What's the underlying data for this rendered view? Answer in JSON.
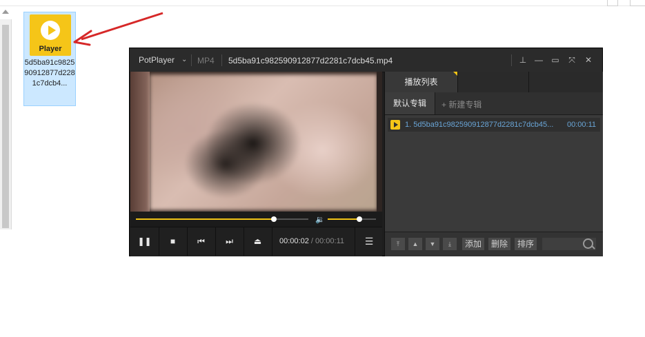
{
  "desktop": {
    "file_icon_label": "Player",
    "file_name": "5d5ba91c982590912877d2281c7dcb4..."
  },
  "player": {
    "brand": "PotPlayer",
    "brand_caret": "⌄",
    "format": "MP4",
    "title": "5d5ba91c982590912877d2281c7dcb45.mp4",
    "window_buttons": [
      "pin-icon",
      "minimize-icon",
      "maximize-icon",
      "fullscreen-icon",
      "close-icon"
    ],
    "window_glyphs": {
      "pin": "⊥",
      "minimize": "—",
      "maximize": "▭",
      "fullscreen": "⤧",
      "close": "✕"
    },
    "progress": {
      "position": 0.8
    },
    "volume": {
      "level": 0.65
    },
    "controls": {
      "pause_glyph": "❚❚",
      "stop_glyph": "■",
      "prev_glyph": "⏮",
      "next_glyph": "⏭",
      "eject_glyph": "⏏",
      "menu_glyph": "☰"
    },
    "time_current": "00:00:02",
    "time_sep": " / ",
    "time_total": "00:00:11",
    "volume_glyph": "🔉"
  },
  "playlist": {
    "tab_label": "播放列表",
    "album_default": "默认专辑",
    "album_new": "+ 新建专辑",
    "items": [
      {
        "name": "1. 5d5ba91c982590912877d2281c7dcb45...",
        "duration": "00:00:11"
      }
    ],
    "footer": {
      "move_top": "⤒",
      "move_up": "▲",
      "move_down": "▼",
      "move_bottom": "⤓",
      "add": "添加",
      "delete": "删除",
      "sort": "排序"
    }
  },
  "colors": {
    "accent": "#f2c416",
    "link": "#6aa6d8",
    "annotation": "#d62828"
  }
}
